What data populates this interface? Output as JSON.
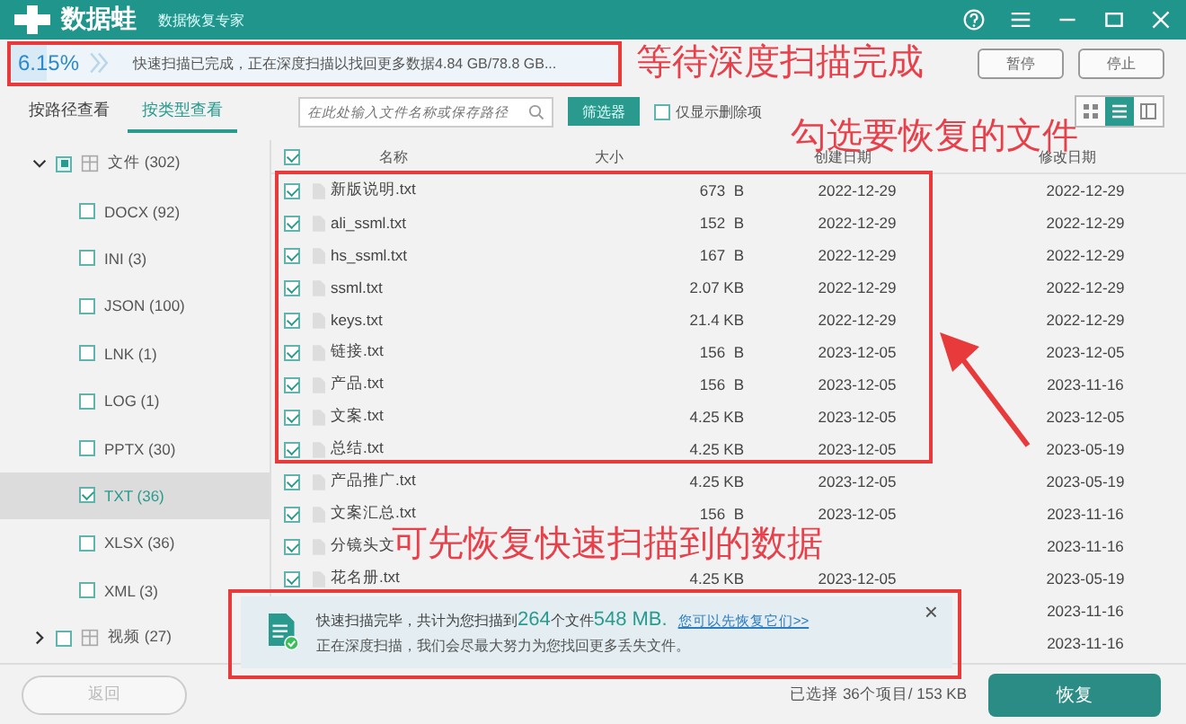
{
  "window": {
    "app_name": "数据蛙",
    "subtitle": "数据恢复专家"
  },
  "scan": {
    "percent": "6.15%",
    "level": 0.06,
    "message": "快速扫描已完成，正在深度扫描以找回更多数据4.84 GB/78.8 GB...",
    "buttons": [
      "暂停",
      "停止"
    ]
  },
  "tabs": [
    {
      "label": "按路径查看",
      "selected": false
    },
    {
      "label": "按类型查看",
      "selected": true
    }
  ],
  "search": {
    "placeholder": "在此处输入文件名称或保存路径"
  },
  "filter_button": "筛选器",
  "deleted_only": {
    "label": "仅显示删除项",
    "checked": false
  },
  "views": [
    {
      "kind": "grid",
      "selected": false
    },
    {
      "kind": "list",
      "selected": true
    },
    {
      "kind": "detail",
      "selected": false
    }
  ],
  "tree": [
    {
      "label": "文件 (302)",
      "expanded": true,
      "checked": true,
      "partial": true,
      "selected": false,
      "children": [
        {
          "label": "DOCX (92)",
          "checked": false,
          "selected": false
        },
        {
          "label": "INI (3)",
          "checked": false,
          "selected": false
        },
        {
          "label": "JSON (100)",
          "checked": false,
          "selected": false
        },
        {
          "label": "LNK (1)",
          "checked": false,
          "selected": false
        },
        {
          "label": "LOG (1)",
          "checked": false,
          "selected": false
        },
        {
          "label": "PPTX (30)",
          "checked": false,
          "selected": false
        },
        {
          "label": "TXT (36)",
          "checked": true,
          "selected": true
        },
        {
          "label": "XLSX (36)",
          "checked": false,
          "selected": false
        },
        {
          "label": "XML (3)",
          "checked": false,
          "selected": false
        }
      ]
    },
    {
      "label": "视频 (27)",
      "expanded": false,
      "checked": false,
      "partial": false,
      "selected": false
    }
  ],
  "table": {
    "all_checked": true,
    "columns": [
      "名称",
      "大小",
      "创建日期",
      "修改日期"
    ],
    "rows": [
      {
        "checked": true,
        "name": "新版说明.txt",
        "size": "673  B",
        "created": "2022-12-29",
        "modified": "2022-12-29"
      },
      {
        "checked": true,
        "name": "ali_ssml.txt",
        "size": "152  B",
        "created": "2022-12-29",
        "modified": "2022-12-29"
      },
      {
        "checked": true,
        "name": "hs_ssml.txt",
        "size": "167  B",
        "created": "2022-12-29",
        "modified": "2022-12-29"
      },
      {
        "checked": true,
        "name": "ssml.txt",
        "size": "2.07 KB",
        "created": "2022-12-29",
        "modified": "2022-12-29"
      },
      {
        "checked": true,
        "name": "keys.txt",
        "size": "21.4 KB",
        "created": "2022-12-29",
        "modified": "2022-12-29"
      },
      {
        "checked": true,
        "name": "链接.txt",
        "size": "156  B",
        "created": "2023-12-05",
        "modified": "2023-12-05"
      },
      {
        "checked": true,
        "name": "产品.txt",
        "size": "156  B",
        "created": "2023-12-05",
        "modified": "2023-11-16"
      },
      {
        "checked": true,
        "name": "文案.txt",
        "size": "4.25 KB",
        "created": "2023-12-05",
        "modified": "2023-12-05"
      },
      {
        "checked": true,
        "name": "总结.txt",
        "size": "4.25 KB",
        "created": "2023-12-05",
        "modified": "2023-05-19"
      },
      {
        "checked": true,
        "name": "产品推广.txt",
        "size": "4.25 KB",
        "created": "2023-12-05",
        "modified": "2023-05-19"
      },
      {
        "checked": true,
        "name": "文案汇总.txt",
        "size": "156  B",
        "created": "2023-12-05",
        "modified": "2023-11-16"
      },
      {
        "checked": true,
        "name": "分镜头文",
        "modified": "2023-11-16"
      },
      {
        "checked": true,
        "name": "花名册.txt",
        "size": "4.25 KB",
        "created": "2023-12-05",
        "modified": "2023-05-19"
      },
      {
        "modified": "2023-11-16"
      },
      {
        "modified": "2023-11-16"
      }
    ]
  },
  "notice": {
    "line1": [
      {
        "kind": "plain",
        "text": "快速扫描完毕，共计为您扫描到"
      },
      {
        "kind": "number",
        "text": "264"
      },
      {
        "kind": "plain",
        "text": "个文件"
      },
      {
        "kind": "number",
        "text": "548 MB."
      }
    ],
    "link": "您可以先恢复它们>>",
    "line2": "正在深度扫描，我们会尽最大努力为您找回更多丢失文件。",
    "close": "×"
  },
  "footer": {
    "back": "返回",
    "back_disabled": true,
    "selection": "已选择 36个项目/ 153 KB",
    "recover": "恢复"
  },
  "annotations": {
    "progress_note": "等待深度扫描完成",
    "select_note": "勾选要恢复的文件",
    "recover_note": "可先恢复快速扫描到的数据"
  }
}
